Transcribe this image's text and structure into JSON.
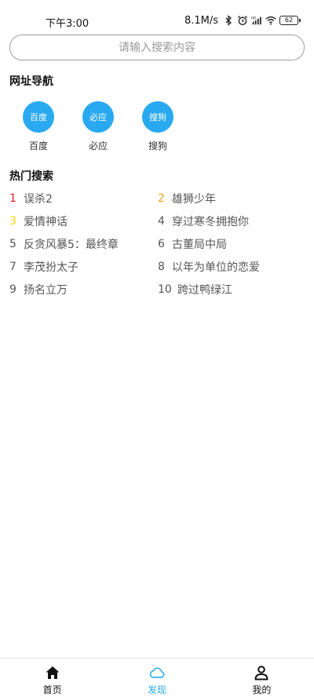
{
  "status_bar": {
    "time": "下午3:00",
    "net_speed": "8.1M/s",
    "battery": "62"
  },
  "search": {
    "placeholder": "请输入搜索内容"
  },
  "nav_section": {
    "title": "网址导航",
    "items": [
      {
        "circle_text": "百度",
        "label": "百度"
      },
      {
        "circle_text": "必应",
        "label": "必应"
      },
      {
        "circle_text": "搜狗",
        "label": "搜狗"
      }
    ]
  },
  "hot_section": {
    "title": "热门搜索",
    "items": [
      {
        "rank": "1",
        "text": "误杀2",
        "rank_color": "#e02020"
      },
      {
        "rank": "2",
        "text": "雄狮少年",
        "rank_color": "#f0a020"
      },
      {
        "rank": "3",
        "text": "爱情神话",
        "rank_color": "#f5d800"
      },
      {
        "rank": "4",
        "text": "穿过寒冬拥抱你",
        "rank_color": "#555555"
      },
      {
        "rank": "5",
        "text": "反贪风暴5：最终章",
        "rank_color": "#555555"
      },
      {
        "rank": "6",
        "text": "古董局中局",
        "rank_color": "#555555"
      },
      {
        "rank": "7",
        "text": "李茂扮太子",
        "rank_color": "#555555"
      },
      {
        "rank": "8",
        "text": "以年为单位的恋爱",
        "rank_color": "#555555"
      },
      {
        "rank": "9",
        "text": "扬名立万",
        "rank_color": "#555555"
      },
      {
        "rank": "10",
        "text": "跨过鸭绿江",
        "rank_color": "#555555"
      }
    ]
  },
  "bottom_nav": {
    "active_color": "#29a9f0",
    "tabs": [
      {
        "label": "首页",
        "icon": "home-icon"
      },
      {
        "label": "发现",
        "icon": "cloud-icon"
      },
      {
        "label": "我的",
        "icon": "person-icon"
      }
    ]
  }
}
